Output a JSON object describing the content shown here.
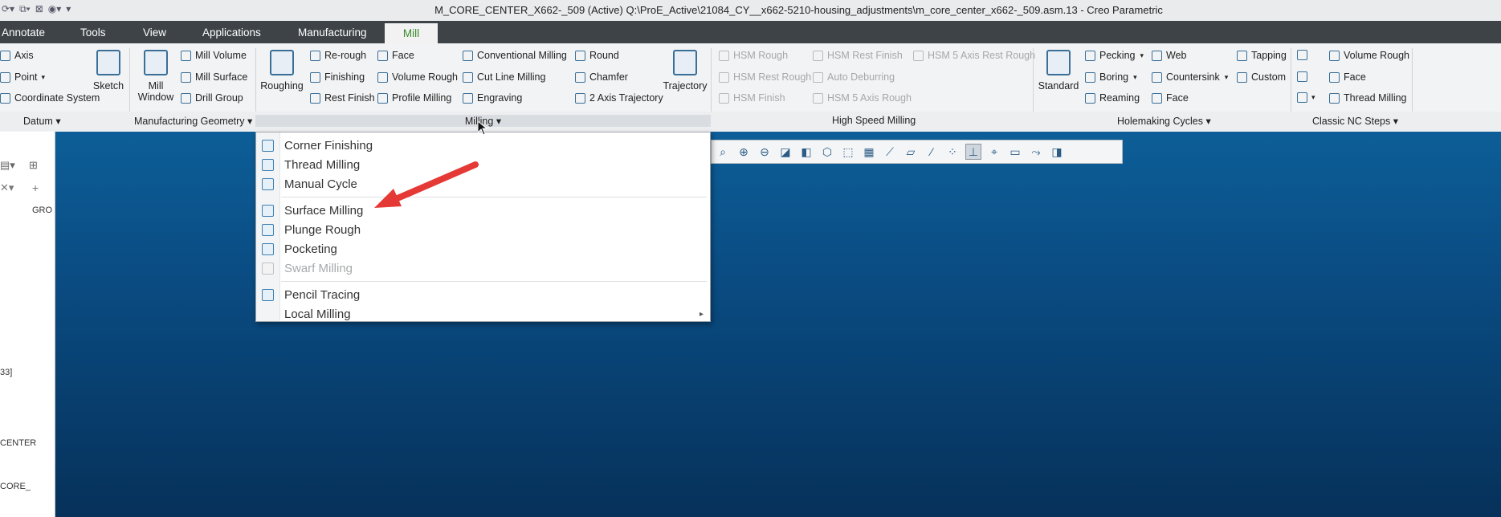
{
  "window": {
    "title": "M_CORE_CENTER_X662-_509 (Active) Q:\\ProE_Active\\21084_CY__x662-5210-housing_adjustments\\m_core_center_x662-_509.asm.13 - Creo Parametric"
  },
  "tabs": [
    {
      "label": "Annotate"
    },
    {
      "label": "Tools"
    },
    {
      "label": "View"
    },
    {
      "label": "Applications"
    },
    {
      "label": "Manufacturing"
    },
    {
      "label": "Mill",
      "active": true
    }
  ],
  "ribbon": {
    "datum": {
      "items": [
        "Axis",
        "Point",
        "Coordinate System"
      ],
      "sketch": "Sketch",
      "group_label": "Datum"
    },
    "mfg_geometry": {
      "mill_window": "Mill Window",
      "items": [
        "Mill Volume",
        "Mill Surface",
        "Drill Group"
      ],
      "group_label": "Manufacturing Geometry"
    },
    "milling": {
      "roughing": "Roughing",
      "col1": [
        "Re-rough",
        "Finishing",
        "Rest Finish"
      ],
      "col2": [
        "Face",
        "Volume Rough",
        "Profile Milling"
      ],
      "col3": [
        "Conventional Milling",
        "Cut Line Milling",
        "Engraving"
      ],
      "col4": [
        "Round",
        "Chamfer",
        "2 Axis Trajectory"
      ],
      "trajectory": "Trajectory",
      "group_label": "Milling"
    },
    "hsm": {
      "col1": [
        "HSM Rough",
        "HSM Rest Rough",
        "HSM Finish"
      ],
      "col2": [
        "HSM Rest Finish",
        "Auto Deburring",
        "HSM 5 Axis Rough"
      ],
      "col3": [
        "HSM 5 Axis Rest Rough"
      ],
      "group_label": "High Speed Milling"
    },
    "holemaking": {
      "standard": "Standard",
      "col1": [
        "Pecking",
        "Boring",
        "Reaming"
      ],
      "col2": [
        "Web",
        "Countersink",
        "Face"
      ],
      "col3": [
        "Tapping",
        "Custom"
      ],
      "group_label": "Holemaking Cycles"
    },
    "classic": {
      "col1": [
        "Volume Rough",
        "Face",
        "Thread Milling"
      ],
      "group_label": "Classic NC Steps"
    }
  },
  "left_panel": {
    "col_header": "GRO",
    "frag1": "33]",
    "frag2": "CENTER",
    "frag3": "CORE_"
  },
  "milling_menu": {
    "items": [
      {
        "label": "Corner Finishing",
        "enabled": true
      },
      {
        "label": "Thread Milling",
        "enabled": true
      },
      {
        "label": "Manual Cycle",
        "enabled": true
      },
      {
        "label": "Surface Milling",
        "enabled": true
      },
      {
        "label": "Plunge Rough",
        "enabled": true
      },
      {
        "label": "Pocketing",
        "enabled": true
      },
      {
        "label": "Swarf Milling",
        "enabled": false
      },
      {
        "label": "Pencil Tracing",
        "enabled": true
      },
      {
        "label": "Local Milling",
        "enabled": true,
        "submenu": true
      }
    ]
  },
  "colors": {
    "accent_green": "#3a8a2c",
    "tab_bar": "#3d4347",
    "graphics_top": "#0d5e98",
    "graphics_bottom": "#06315a",
    "annotation_red": "#e53935"
  }
}
